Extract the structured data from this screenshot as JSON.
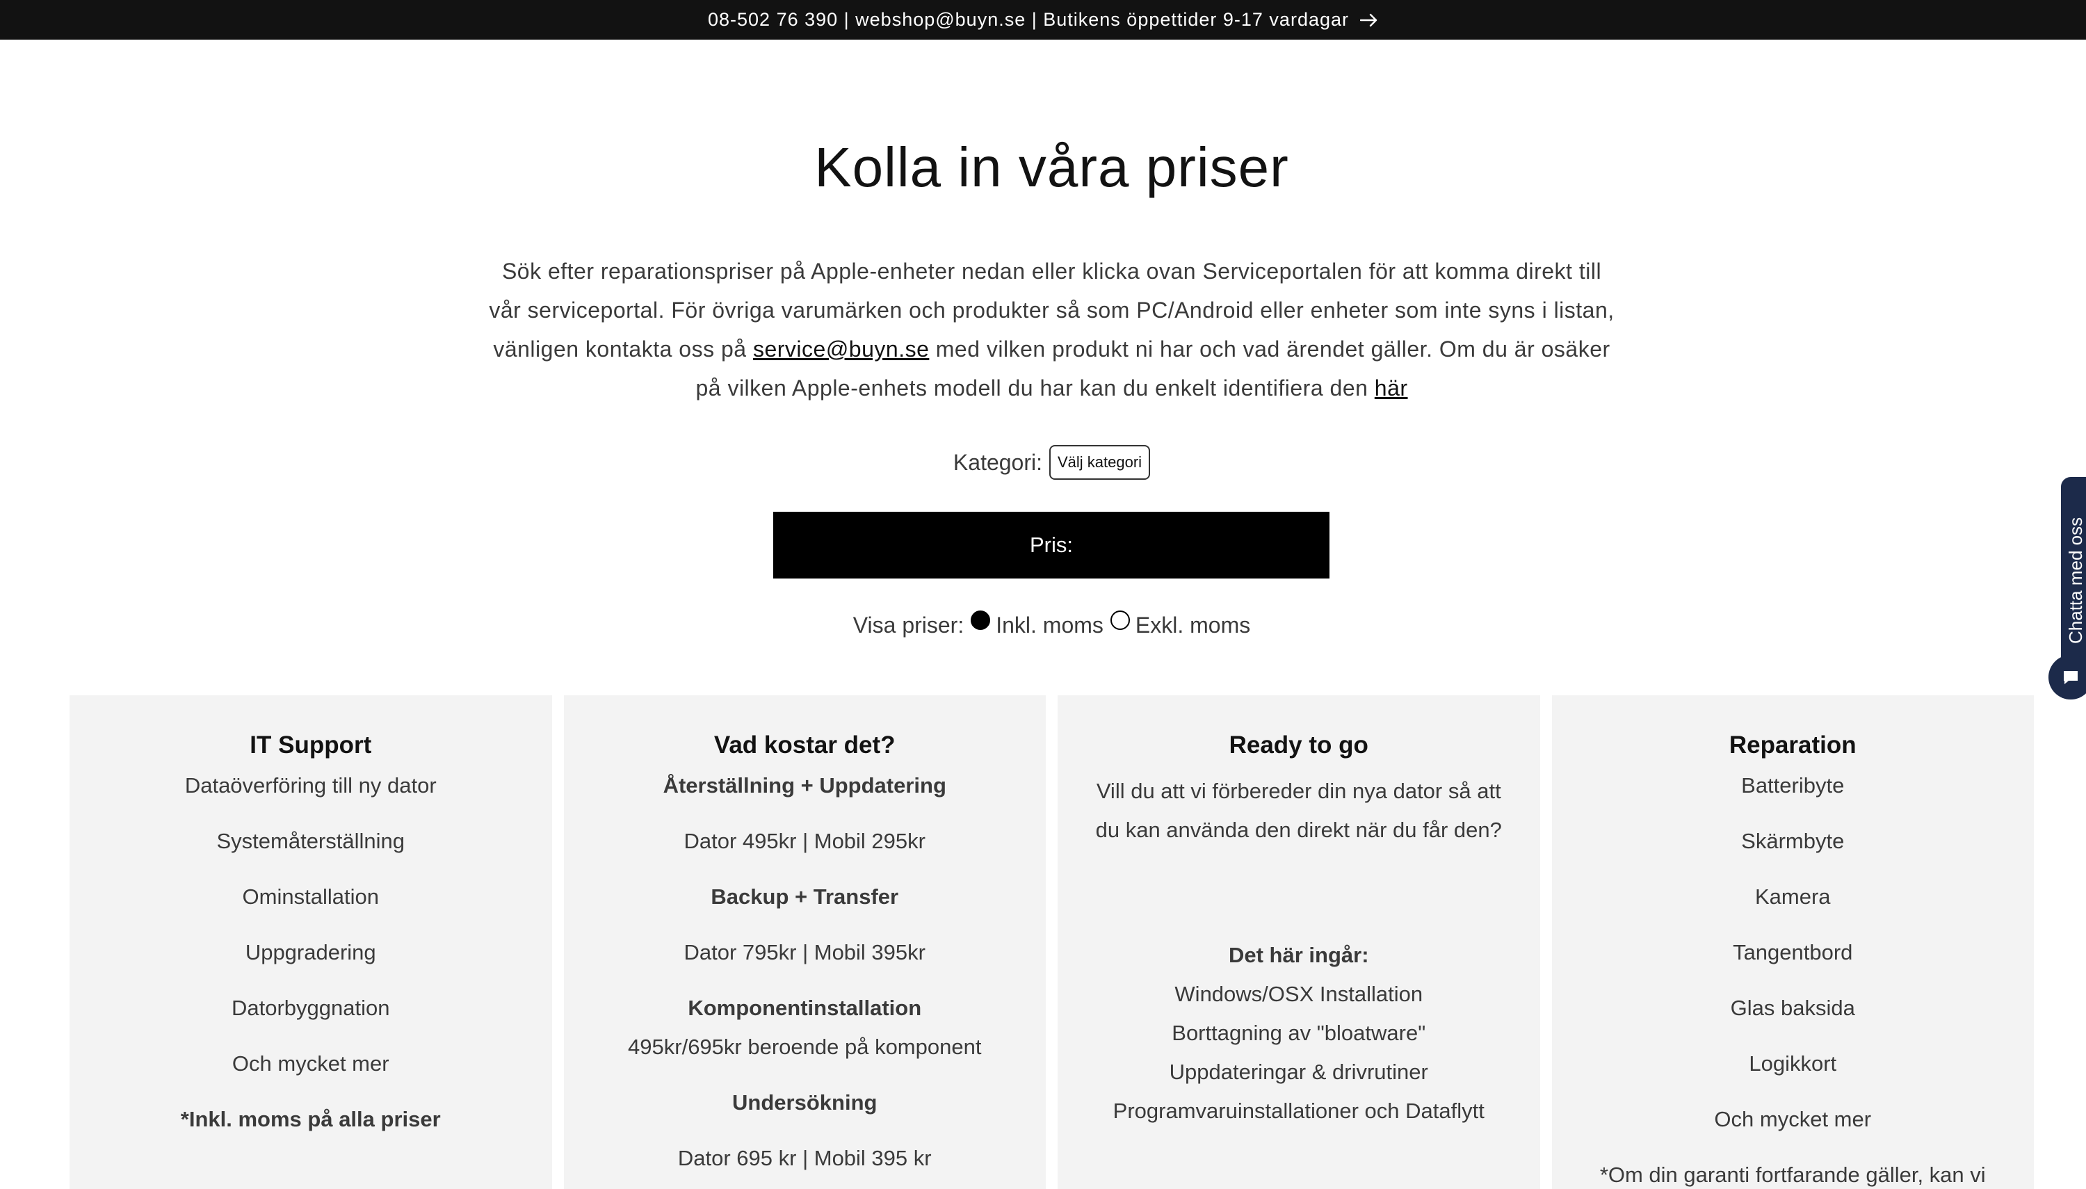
{
  "announcement": {
    "text": "08-502 76 390 | webshop@buyn.se | Butikens öppettider 9-17 vardagar"
  },
  "page": {
    "title": "Kolla in våra priser",
    "intro_part1": "Sök efter reparationspriser på Apple-enheter nedan eller klicka ovan Serviceportalen för att komma direkt till vår serviceportal. För övriga varumärken och produkter så som PC/Android eller enheter som inte syns i listan, vänligen kontakta oss på ",
    "intro_email": "service@buyn.se",
    "intro_part2": " med vilken produkt ni har och vad ärendet gäller. Om du är osäker på vilken Apple-enhets modell du har kan du enkelt identifiera den ",
    "intro_link": "här"
  },
  "filter": {
    "category_label": "Kategori:",
    "category_selected": "Välj kategori",
    "price_label": "Pris:",
    "show_prices_label": "Visa priser:",
    "option_incl": "Inkl. moms",
    "option_excl": "Exkl. moms",
    "selected_option": "Inkl. moms"
  },
  "cards": {
    "it_support": {
      "title": "IT Support",
      "items": [
        "Dataöverföring till ny dator",
        "Systemåterställning",
        "Ominstallation",
        "Uppgradering",
        "Datorbyggnation",
        "Och mycket mer"
      ],
      "note": "*Inkl. moms på alla priser"
    },
    "cost": {
      "title": "Vad kostar det?",
      "h1": "Återställning + Uppdatering",
      "p1": "Dator 495kr | Mobil 295kr",
      "h2": "Backup + Transfer",
      "p2": "Dator 795kr | Mobil 395kr",
      "h3": "Komponentinstallation",
      "p3": "495kr/695kr beroende på komponent",
      "h4": "Undersökning",
      "p4": "Dator 695 kr | Mobil 395 kr"
    },
    "ready": {
      "title": "Ready to go",
      "intro": "Vill du att vi förbereder din nya dator så att du kan använda den direkt när du får den?",
      "included_heading": "Det här ingår:",
      "included": [
        "Windows/OSX Installation",
        "Borttagning av \"bloatware\"",
        "Uppdateringar & drivrutiner",
        "Programvaruinstallationer och Dataflytt"
      ]
    },
    "repair": {
      "title": "Reparation",
      "items": [
        "Batteribyte",
        "Skärmbyte",
        "Kamera",
        "Tangentbord",
        "Glas baksida",
        "Logikkort",
        "Och mycket mer"
      ],
      "note": "*Om din garanti fortfarande gäller, kan vi"
    }
  },
  "chat": {
    "tab_label": "Chatta med oss"
  },
  "colors": {
    "announcement_bg": "#121212",
    "card_bg": "#f3f3f3",
    "price_bar_bg": "#000000",
    "chat_bg": "#1c2a4a"
  }
}
